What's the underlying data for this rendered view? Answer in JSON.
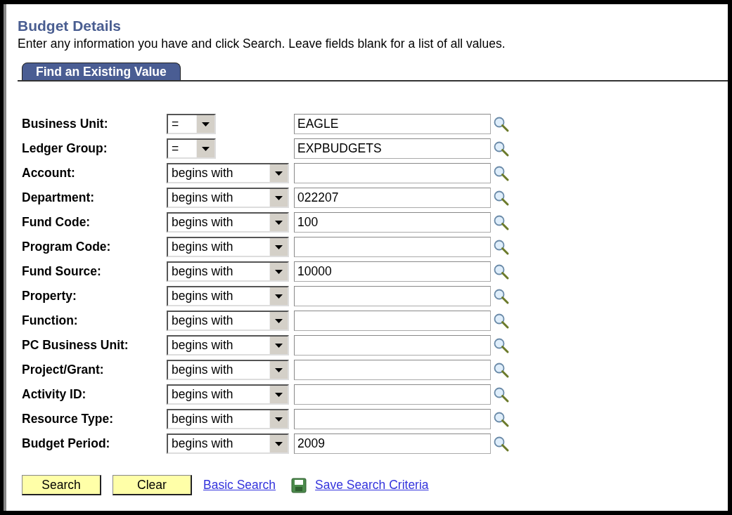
{
  "page": {
    "title": "Budget Details",
    "instructions": "Enter any information you have and click Search. Leave fields blank for a list of all values."
  },
  "tabs": [
    {
      "label": "Find an Existing Value",
      "selected": true
    }
  ],
  "fields": [
    {
      "label": "Business Unit:",
      "operator": "=",
      "value": "EAGLE"
    },
    {
      "label": "Ledger Group:",
      "operator": "=",
      "value": "EXPBUDGETS"
    },
    {
      "label": "Account:",
      "operator": "begins with"
    },
    {
      "label": "Department:",
      "operator": "begins with",
      "value": "022207"
    },
    {
      "label": "Fund Code:",
      "operator": "begins with",
      "value": "100"
    },
    {
      "label": "Program Code:",
      "operator": "begins with"
    },
    {
      "label": "Fund Source:",
      "operator": "begins with",
      "value": "10000"
    },
    {
      "label": "Property:",
      "operator": "begins with"
    },
    {
      "label": "Function:",
      "operator": "begins with"
    },
    {
      "label": "PC Business Unit:",
      "operator": "begins with"
    },
    {
      "label": "Project/Grant:",
      "operator": "begins with"
    },
    {
      "label": "Activity ID:",
      "operator": "begins with"
    },
    {
      "label": "Resource Type:",
      "operator": "begins with"
    },
    {
      "label": "Budget Period:",
      "operator": "begins with",
      "value": "2009"
    }
  ],
  "actions": [
    {
      "kind": "button",
      "label": "Search"
    },
    {
      "kind": "button",
      "label": "Clear"
    },
    {
      "kind": "link",
      "label": "Basic Search"
    },
    {
      "kind": "save-link",
      "label": "Save Search Criteria"
    }
  ]
}
